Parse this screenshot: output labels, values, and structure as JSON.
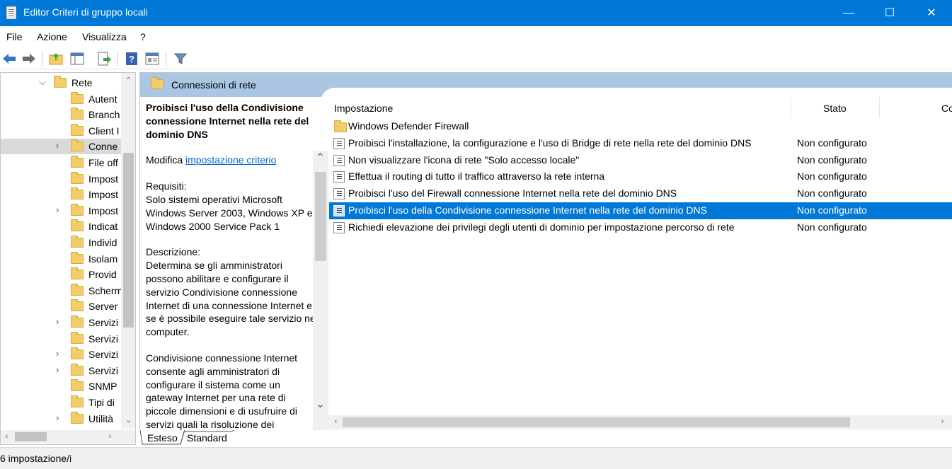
{
  "window": {
    "title": "Editor Criteri di gruppo locali",
    "minimize": "—",
    "maximize": "☐",
    "close": "✕"
  },
  "menu": [
    "File",
    "Azione",
    "Visualizza",
    "?"
  ],
  "toolbar": [
    "back-icon",
    "forward-icon",
    "up-folder-icon",
    "show-hide-tree-icon",
    "export-list-icon",
    "help-icon",
    "properties-icon",
    "filter-icon"
  ],
  "tree": {
    "items": [
      {
        "label": "Rete",
        "expander": "⌵",
        "indent": 0
      },
      {
        "label": "Autent",
        "expander": "",
        "indent": 1
      },
      {
        "label": "Branch",
        "expander": "",
        "indent": 1
      },
      {
        "label": "Client I",
        "expander": "",
        "indent": 1
      },
      {
        "label": "Conne",
        "expander": "›",
        "indent": 1,
        "selected": true
      },
      {
        "label": "File off",
        "expander": "",
        "indent": 1
      },
      {
        "label": "Impost",
        "expander": "",
        "indent": 1
      },
      {
        "label": "Impost",
        "expander": "",
        "indent": 1
      },
      {
        "label": "Impost",
        "expander": "›",
        "indent": 1
      },
      {
        "label": "Indicat",
        "expander": "",
        "indent": 1
      },
      {
        "label": "Individ",
        "expander": "",
        "indent": 1
      },
      {
        "label": "Isolam",
        "expander": "",
        "indent": 1
      },
      {
        "label": "Provid",
        "expander": "",
        "indent": 1
      },
      {
        "label": "Scherm",
        "expander": "",
        "indent": 1
      },
      {
        "label": "Server",
        "expander": "",
        "indent": 1
      },
      {
        "label": "Servizi",
        "expander": "›",
        "indent": 1
      },
      {
        "label": "Servizi",
        "expander": "",
        "indent": 1
      },
      {
        "label": "Servizi",
        "expander": "›",
        "indent": 1
      },
      {
        "label": "Servizi",
        "expander": "›",
        "indent": 1
      },
      {
        "label": "SNMP",
        "expander": "",
        "indent": 1
      },
      {
        "label": "Tipi di",
        "expander": "",
        "indent": 1
      },
      {
        "label": "Utilità",
        "expander": "›",
        "indent": 1
      }
    ]
  },
  "header": {
    "folder_title": "Connessioni di rete"
  },
  "description": {
    "title": "Proibisci l'uso della Condivisione connessione Internet nella rete del dominio DNS",
    "edit_prefix": "Modifica ",
    "edit_link": "impostazione criterio",
    "req_label": "Requisiti:",
    "req_text": "Solo sistemi operativi Microsoft Windows Server 2003, Windows XP e Windows 2000 Service Pack 1",
    "desc_label": "Descrizione:",
    "desc_text": "Determina se gli amministratori possono abilitare e configurare il servizio Condivisione connessione Internet di una connessione Internet e se è possibile eseguire tale servizio nel computer.",
    "desc_text2": "Condivisione connessione Internet consente agli amministratori di configurare il sistema come un gateway Internet per una rete di piccole dimensioni e di usufruire di servizi quali la risoluzione dei"
  },
  "list": {
    "columns": [
      "Impostazione",
      "Stato",
      "Co"
    ],
    "rows": [
      {
        "name": "Windows Defender Firewall",
        "stato": "",
        "type": "folder"
      },
      {
        "name": "Proibisci l'installazione, la configurazione e l'uso di Bridge di rete nella rete del dominio DNS",
        "stato": "Non configurato",
        "type": "setting"
      },
      {
        "name": "Non visualizzare l'icona di rete \"Solo accesso locale\"",
        "stato": "Non configurato",
        "type": "setting"
      },
      {
        "name": "Effettua il routing di tutto il traffico attraverso la rete interna",
        "stato": "Non configurato",
        "type": "setting"
      },
      {
        "name": "Proibisci l'uso del Firewall connessione Internet nella rete del dominio DNS",
        "stato": "Non configurato",
        "type": "setting"
      },
      {
        "name": "Proibisci l'uso della Condivisione connessione Internet nella rete del dominio DNS",
        "stato": "Non configurato",
        "type": "setting",
        "selected": true
      },
      {
        "name": "Richiedi elevazione dei privilegi degli utenti di dominio per impostazione percorso di rete",
        "stato": "Non configurato",
        "type": "setting"
      }
    ]
  },
  "tabs": [
    "Esteso",
    "Standard"
  ],
  "status": {
    "text": "6 impostazione/i"
  }
}
